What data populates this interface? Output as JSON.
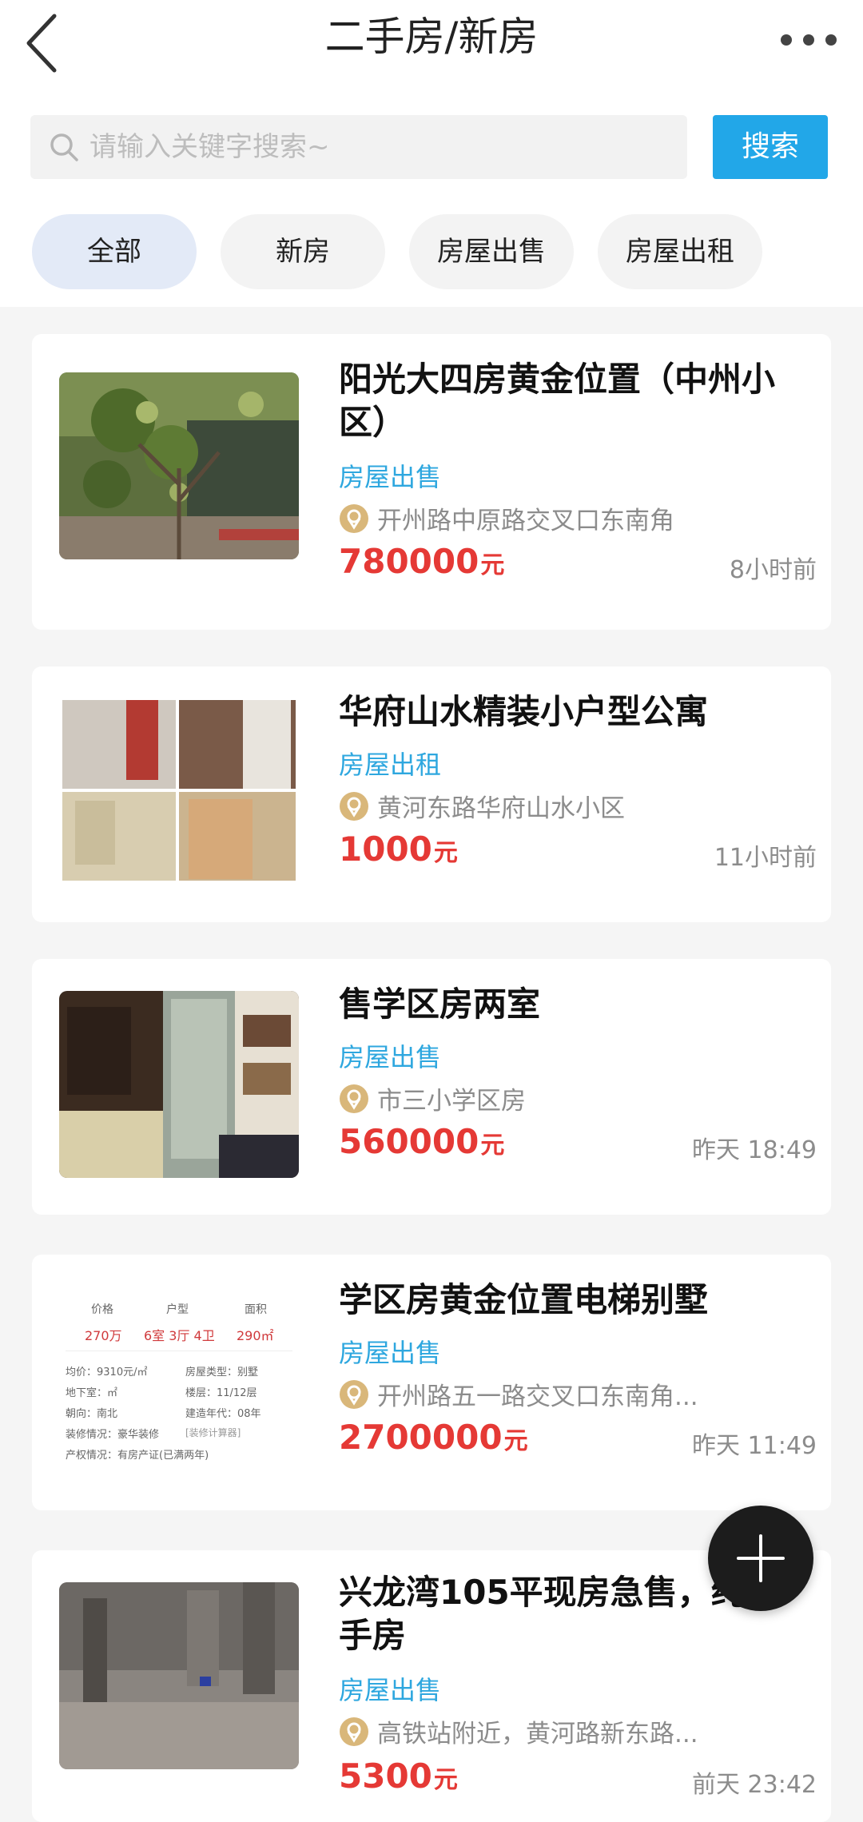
{
  "header": {
    "title": "二手房/新房",
    "back_icon": "chevron-left-icon",
    "more_icon": "more-dots-icon"
  },
  "search": {
    "placeholder": "请输入关键字搜索~",
    "button_label": "搜索",
    "accent": "#22a7e8"
  },
  "tabs": [
    {
      "label": "全部",
      "active": true
    },
    {
      "label": "新房",
      "active": false
    },
    {
      "label": "房屋出售",
      "active": false
    },
    {
      "label": "房屋出租",
      "active": false
    }
  ],
  "listings": [
    {
      "title": "阳光大四房黄金位置（中州小区）",
      "type": "房屋出售",
      "address": "开州路中原路交叉口东南角",
      "price": "780000",
      "unit": "元",
      "time": "8小时前"
    },
    {
      "title": "华府山水精装小户型公寓",
      "type": "房屋出租",
      "address": "黄河东路华府山水小区",
      "price": "1000",
      "unit": "元",
      "time": "11小时前"
    },
    {
      "title": "售学区房两室",
      "type": "房屋出售",
      "address": "市三小学区房",
      "price": "560000",
      "unit": "元",
      "time": "昨天 18:49"
    },
    {
      "title": "学区房黄金位置电梯别墅",
      "type": "房屋出售",
      "address": "开州路五一路交叉口东南角...",
      "price": "2700000",
      "unit": "元",
      "time": "昨天 11:49",
      "info_image": {
        "h1": "价格",
        "h2": "户型",
        "h3": "面积",
        "v1": "270万",
        "v2": "6室 3厅 4卫",
        "v3": "290㎡",
        "r1a": "均价：9310元/㎡",
        "r1b": "房屋类型：别墅",
        "r2a": "地下室：㎡",
        "r2b": "楼层：11/12层",
        "r3a": "朝向：南北",
        "r3b": "建造年代：08年",
        "r4a": "装修情况：豪华装修",
        "r4b": "[装修计算器]",
        "r5a": "产权情况：有房产证(已满两年)"
      }
    },
    {
      "title": "兴龙湾105平现房急售，纯一手房",
      "type": "房屋出售",
      "address": "高铁站附近，黄河路新东路...",
      "price": "5300",
      "unit": "元",
      "time": "前天 23:42"
    }
  ],
  "fab": {
    "icon": "plus-icon"
  },
  "colors": {
    "price": "#e53935",
    "type": "#2ea7df",
    "meta": "#8c8c8c"
  }
}
